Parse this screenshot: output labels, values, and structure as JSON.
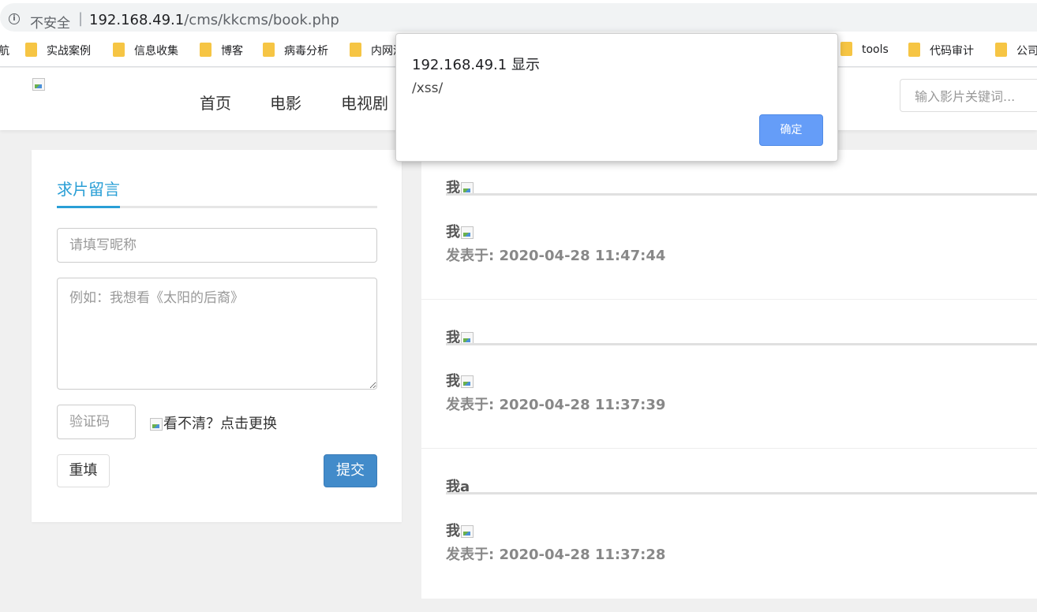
{
  "browser": {
    "not_secure": "不安全",
    "separator": "|",
    "url_host": "192.168.49.1",
    "url_path": "/cms/kkcms/book.php",
    "bookmarks": [
      {
        "label": "航"
      },
      {
        "label": "实战案例"
      },
      {
        "label": "信息收集"
      },
      {
        "label": "博客"
      },
      {
        "label": "病毒分析"
      },
      {
        "label": "内网渗"
      },
      {
        "label": "tools"
      },
      {
        "label": "代码审计"
      },
      {
        "label": "公司"
      }
    ]
  },
  "header": {
    "nav": [
      "首页",
      "电影",
      "电视剧"
    ],
    "search_placeholder": "输入影片关键词..."
  },
  "form": {
    "title": "求片留言",
    "nickname_placeholder": "请填写昵称",
    "message_placeholder": "例如：我想看《太阳的后裔》",
    "captcha_placeholder": "验证码",
    "captcha_hint": "看不清？点击更换",
    "reset_label": "重填",
    "submit_label": "提交"
  },
  "comments": [
    {
      "name": "我",
      "content": "我",
      "time": "发表于: 2020-04-28 11:47:44"
    },
    {
      "name": "我",
      "content": "我",
      "time": "发表于: 2020-04-28 11:37:39"
    },
    {
      "name": "我a",
      "content": "我",
      "time": "发表于: 2020-04-28 11:37:28"
    }
  ],
  "dialog": {
    "title": "192.168.49.1 显示",
    "message": "/xss/",
    "ok_label": "确定"
  },
  "colors": {
    "accent": "#2a9fd6",
    "submit_button": "#428bca",
    "dialog_ok": "#659df8",
    "bookmark_folder": "#f6c544"
  }
}
